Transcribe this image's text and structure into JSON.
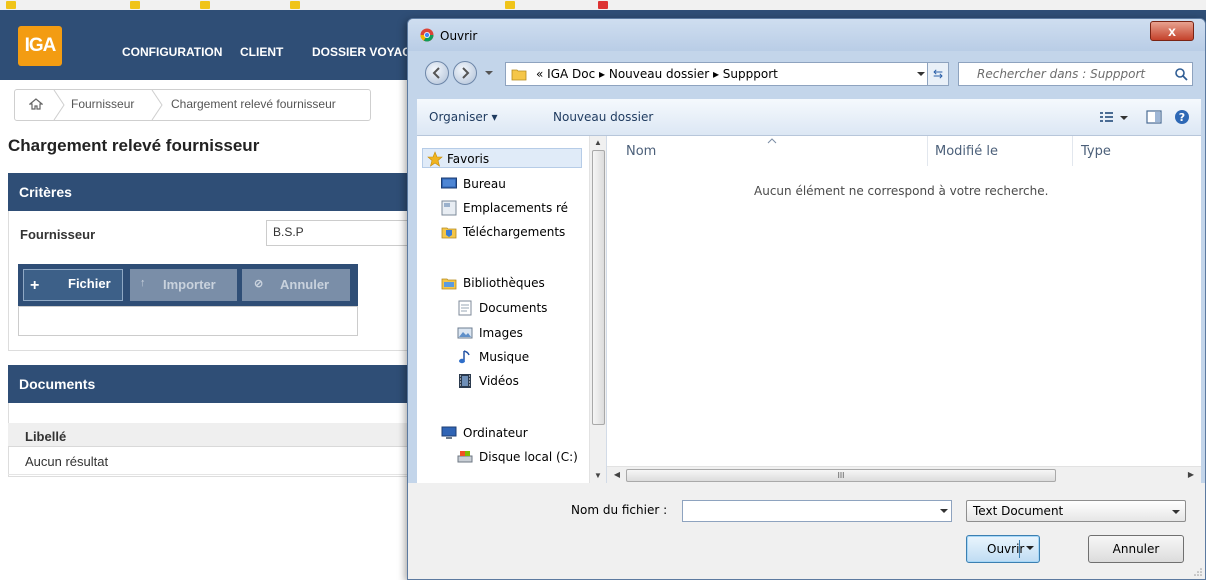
{
  "app": {
    "logo": "IGA",
    "nav": [
      "CONFIGURATION",
      "CLIENT",
      "DOSSIER VOYAG"
    ],
    "breadcrumb": [
      "Fournisseur",
      "Chargement relevé fournisseur"
    ],
    "page_title": "Chargement relevé fournisseur",
    "criteria": {
      "header": "Critères",
      "supplier_label": "Fournisseur",
      "supplier_value": "B.S.P",
      "buttons": {
        "file": "Fichier",
        "import": "Importer",
        "cancel": "Annuler"
      }
    },
    "documents": {
      "header": "Documents",
      "column": "Libellé",
      "empty": "Aucun résultat"
    },
    "colors": {
      "brand_blue": "#2f4e76",
      "logo_orange": "#f39c12"
    }
  },
  "dialog": {
    "title": "Ouvrir",
    "close_label": "x",
    "address_path": "« IGA Doc  ▸  Nouveau dossier  ▸  Suppport",
    "search_placeholder": "Rechercher dans : Suppport",
    "toolbar": {
      "organize": "Organiser ▾",
      "new_folder": "Nouveau dossier"
    },
    "tree": {
      "favorites": "Favoris",
      "desktop": "Bureau",
      "recent_places": "Emplacements ré",
      "downloads": "Téléchargements",
      "libraries": "Bibliothèques",
      "documents": "Documents",
      "images": "Images",
      "music": "Musique",
      "videos": "Vidéos",
      "computer": "Ordinateur",
      "local_disk": "Disque local (C:)"
    },
    "columns": [
      "Nom",
      "Modifié le",
      "Type"
    ],
    "empty_message": "Aucun élément ne correspond à votre recherche.",
    "filename_label": "Nom du fichier :",
    "filename_value": "",
    "file_type": "Text Document",
    "open_button": "Ouvrir",
    "cancel_button": "Annuler",
    "hscroll_grip": "III"
  }
}
